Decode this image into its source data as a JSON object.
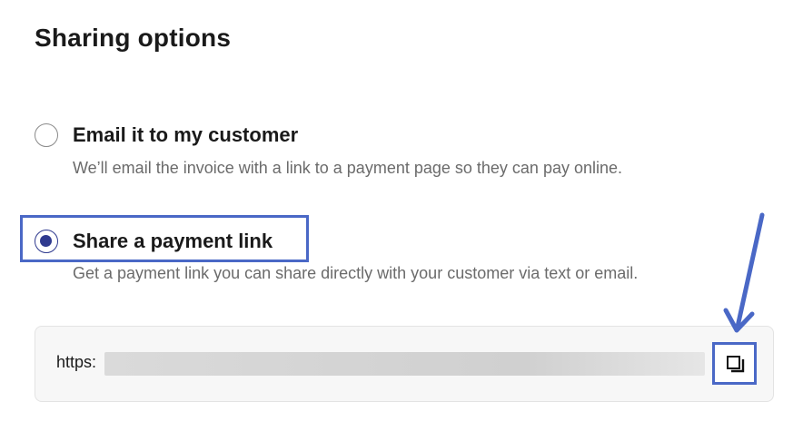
{
  "header": {
    "title": "Sharing options"
  },
  "options": [
    {
      "label": "Email it to my customer",
      "description": "We’ll email the invoice with a link to a payment page so they can pay online.",
      "selected": false
    },
    {
      "label": "Share a payment link",
      "description": "Get a payment link you can share directly with your customer via text or email.",
      "selected": true
    }
  ],
  "link": {
    "prefix": "https:"
  },
  "icons": {
    "copy": "copy-icon",
    "annotation_arrow": "arrow-icon"
  },
  "colors": {
    "accent": "#2f3a8f",
    "annotation": "#4a68c6"
  }
}
